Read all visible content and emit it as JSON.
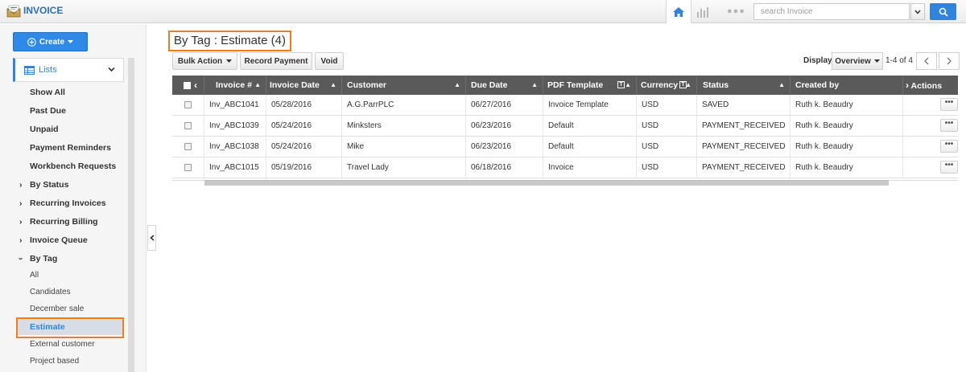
{
  "header": {
    "app_title": "INVOICE",
    "search_placeholder": "search Invoice"
  },
  "colors": {
    "accent": "#2e84de",
    "highlight": "#f07c1c",
    "grid_header": "#5a5a5a"
  },
  "icons": {
    "logo": "invoice-envelope-icon",
    "home": "home-icon",
    "analytics": "bar-chart-icon",
    "more": "more-dots-icon",
    "search": "search-icon"
  },
  "sidebar": {
    "create_label": "Create",
    "lists_label": "Lists",
    "items": [
      {
        "label": "Show All",
        "kind": "bold"
      },
      {
        "label": "Past Due",
        "kind": "bold"
      },
      {
        "label": "Unpaid",
        "kind": "bold"
      },
      {
        "label": "Payment Reminders",
        "kind": "bold"
      },
      {
        "label": "Workbench Requests",
        "kind": "bold"
      },
      {
        "label": "By Status",
        "kind": "collapsed"
      },
      {
        "label": "Recurring Invoices",
        "kind": "collapsed"
      },
      {
        "label": "Recurring Billing",
        "kind": "collapsed"
      },
      {
        "label": "Invoice Queue",
        "kind": "collapsed"
      },
      {
        "label": "By Tag",
        "kind": "expanded"
      },
      {
        "label": "All",
        "kind": "sub"
      },
      {
        "label": "Candidates",
        "kind": "sub"
      },
      {
        "label": "December sale",
        "kind": "sub"
      },
      {
        "label": "Estimate",
        "kind": "active"
      },
      {
        "label": "External customer",
        "kind": "sub"
      },
      {
        "label": "Project based",
        "kind": "sub"
      }
    ]
  },
  "main": {
    "title": "By Tag : Estimate (4)",
    "toolbar": {
      "bulk_action": "Bulk Action",
      "record_payment": "Record Payment",
      "void": "Void",
      "display_label": "Display",
      "display_value": "Overview",
      "page_range": "1-4 of 4"
    },
    "columns": [
      "Invoice #",
      "Invoice Date",
      "Customer",
      "Due Date",
      "PDF Template",
      "Currency",
      "Status",
      "Created by",
      "Actions"
    ],
    "rows": [
      {
        "invoice": "Inv_ABC1041",
        "invoice_date": "05/28/2016",
        "customer": "A.G.ParrPLC",
        "due_date": "06/27/2016",
        "template": "Invoice Template",
        "currency": "USD",
        "status": "SAVED",
        "created_by": "Ruth k. Beaudry"
      },
      {
        "invoice": "Inv_ABC1039",
        "invoice_date": "05/24/2016",
        "customer": "Minksters",
        "due_date": "06/23/2016",
        "template": "Default",
        "currency": "USD",
        "status": "PAYMENT_RECEIVED",
        "created_by": "Ruth k. Beaudry"
      },
      {
        "invoice": "Inv_ABC1038",
        "invoice_date": "05/24/2016",
        "customer": "Mike",
        "due_date": "06/23/2016",
        "template": "Default",
        "currency": "USD",
        "status": "PAYMENT_RECEIVED",
        "created_by": "Ruth k. Beaudry"
      },
      {
        "invoice": "Inv_ABC1015",
        "invoice_date": "05/19/2016",
        "customer": "Travel Lady",
        "due_date": "06/18/2016",
        "template": "Invoice",
        "currency": "USD",
        "status": "PAYMENT_RECEIVED",
        "created_by": "Ruth k. Beaudry"
      }
    ],
    "actions_glyph": "•••"
  }
}
